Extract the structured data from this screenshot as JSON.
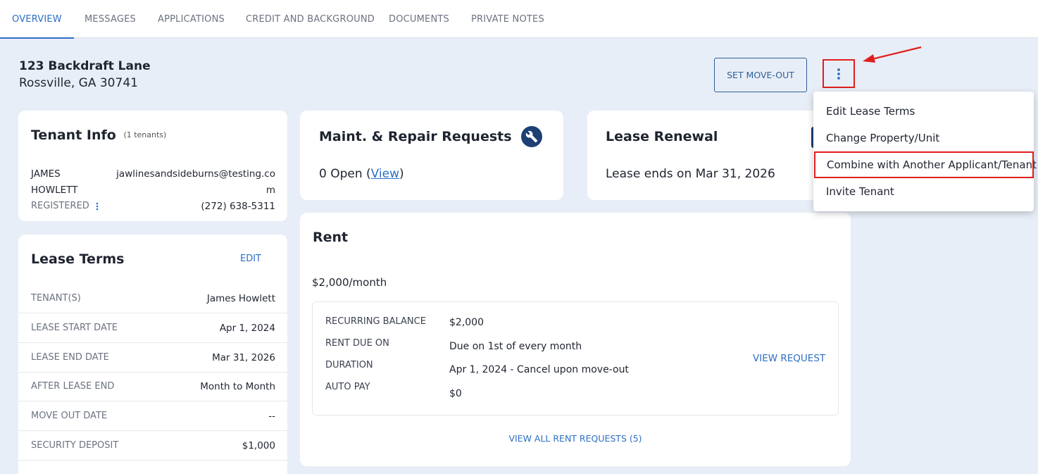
{
  "tabs": [
    {
      "label": "OVERVIEW",
      "active": true
    },
    {
      "label": "MESSAGES"
    },
    {
      "label": "APPLICATIONS"
    },
    {
      "label": "CREDIT AND BACKGROUND"
    },
    {
      "label": "DOCUMENTS"
    },
    {
      "label": "PRIVATE NOTES"
    }
  ],
  "property": {
    "street": "123 Backdraft Lane",
    "city_state_zip": "Rossville, GA 30741"
  },
  "actions": {
    "set_move_out_label": "SET MOVE-OUT",
    "more_icon": "vertical-dots-icon"
  },
  "menu": {
    "items": [
      {
        "label": "Edit Lease Terms"
      },
      {
        "label": "Change Property/Unit"
      },
      {
        "label": "Combine with Another Applicant/Tenant",
        "highlighted": true
      },
      {
        "label": "Invite Tenant"
      }
    ]
  },
  "tenant_info": {
    "title": "Tenant Info",
    "count_note": "(1 tenants)",
    "first_name": "JAMES",
    "last_name": "HOWLETT",
    "email_line1": "jawlinesandsideburns@testing.co",
    "email_line2": "m",
    "status": "REGISTERED",
    "phone": "(272) 638-5311"
  },
  "lease_terms": {
    "title": "Lease Terms",
    "edit_label": "EDIT",
    "rows": [
      {
        "label": "TENANT(S)",
        "value": "James Howlett"
      },
      {
        "label": "LEASE START DATE",
        "value": "Apr 1, 2024"
      },
      {
        "label": "LEASE END DATE",
        "value": "Mar 31, 2026"
      },
      {
        "label": "AFTER LEASE END",
        "value": "Month to Month"
      },
      {
        "label": "MOVE OUT DATE",
        "value": "--"
      },
      {
        "label": "SECURITY DEPOSIT",
        "value": "$1,000"
      }
    ]
  },
  "maintenance": {
    "title": "Maint. & Repair Requests",
    "icon": "wrench-icon",
    "open_prefix": "0 Open (",
    "view_link": "View",
    "open_suffix": ")"
  },
  "lease_renewal": {
    "title": "Lease Renewal",
    "text": "Lease ends on Mar 31, 2026"
  },
  "rent": {
    "title": "Rent",
    "amount": "$2,000/month",
    "details": [
      {
        "label": "RECURRING BALANCE",
        "value": "$2,000"
      },
      {
        "label": "RENT DUE ON",
        "value": "Due on 1st of every month"
      },
      {
        "label": "DURATION",
        "value": "Apr 1, 2024 - Cancel upon move-out"
      },
      {
        "label": "AUTO PAY",
        "value": "$0"
      }
    ],
    "view_request_label": "VIEW REQUEST",
    "view_all_label": "VIEW ALL RENT REQUESTS (5)"
  },
  "colors": {
    "accent": "#2d6fc6",
    "highlight_red": "#e01d1d",
    "page_bg": "#e8eef7",
    "icon_navy": "#1d3f73"
  }
}
